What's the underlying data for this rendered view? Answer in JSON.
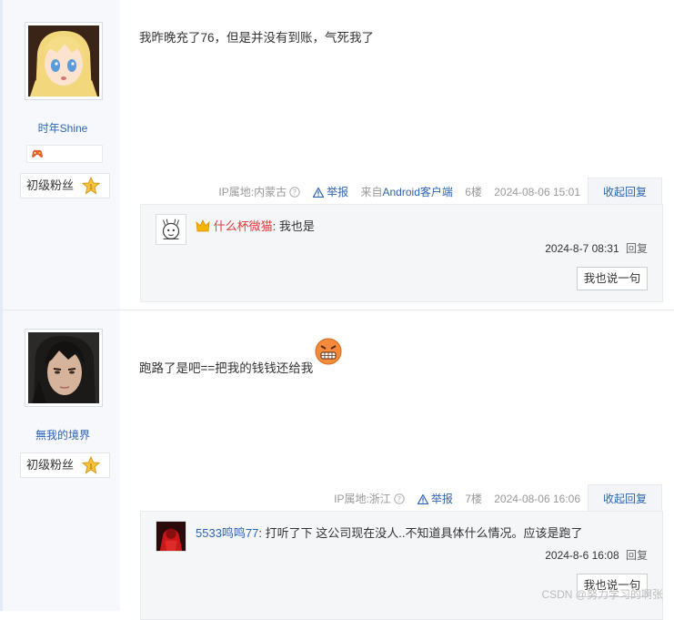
{
  "posts": [
    {
      "username": "时年Shine",
      "level": "初级粉丝",
      "content": "我昨晚充了76，但是并没有到账，气死我了",
      "ip": "IP属地:内蒙古",
      "report": "举报",
      "client_prefix": "来自",
      "client": "Android客户端",
      "floor": "6楼",
      "time": "2024-08-06 15:01",
      "collapse": "收起回复",
      "reply": {
        "user": "什么杯微猫",
        "sep": ":",
        "text": "我也是",
        "time": "2024-8-7 08:31",
        "reply_label": "回复"
      },
      "say_button": "我也说一句"
    },
    {
      "username": "無我的境界",
      "level": "初级粉丝",
      "content": "跑路了是吧==把我的钱钱还给我",
      "ip": "IP属地:浙江",
      "report": "举报",
      "floor": "7楼",
      "time": "2024-08-06 16:06",
      "collapse": "收起回复",
      "reply": {
        "user": "5533鸣鸣77",
        "sep": ":",
        "text": "打听了下 这公司现在没人..不知道具体什么情况。应该是跑了",
        "time": "2024-8-6 16:08",
        "reply_label": "回复"
      },
      "say_button": "我也说一句"
    }
  ],
  "watermark": "CSDN @努力学习的啊张",
  "colors": {
    "link": "#2d64b3",
    "vip": "#e4393c",
    "meta": "#999999",
    "sidebar": "#f6f8fb"
  }
}
